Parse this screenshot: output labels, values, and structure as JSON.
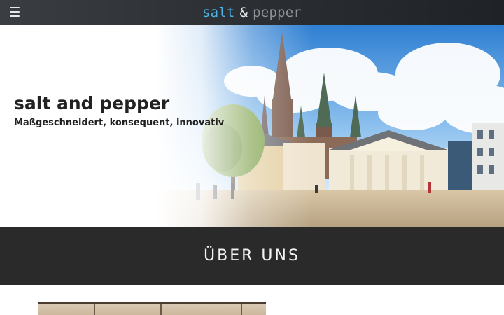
{
  "header": {
    "logo_salt": "salt",
    "logo_amp": "&",
    "logo_pepper": "pepper",
    "menu_icon": "hamburger-menu-icon",
    "colors": {
      "salt": "#49b4e6",
      "amp": "#e6e6e6",
      "pepper": "#8d9096",
      "bar": "#2b2e33"
    }
  },
  "hero": {
    "title": "salt and pepper",
    "subtitle": "Maßgeschneidert, konsequent, innovativ"
  },
  "section": {
    "title": "ÜBER UNS"
  },
  "colors": {
    "band": "#2a2a2a",
    "hero_text": "#222222"
  }
}
